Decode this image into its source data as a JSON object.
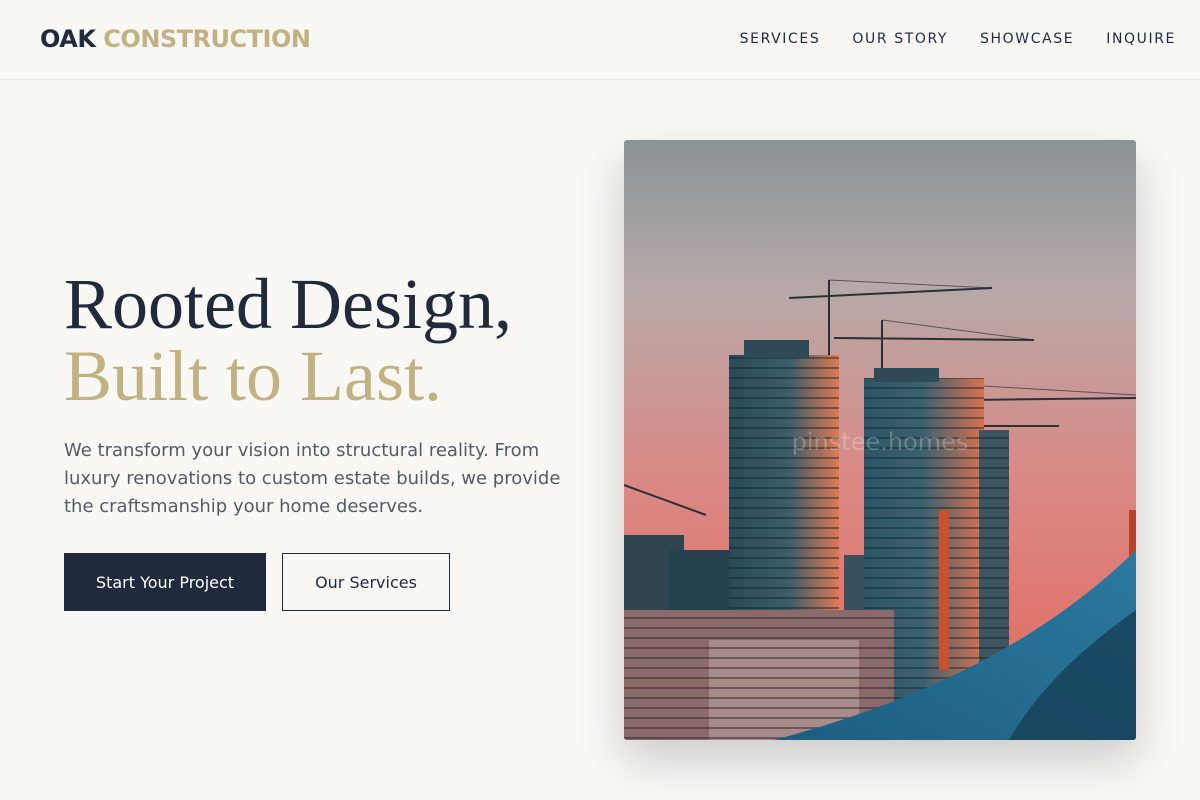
{
  "brand": {
    "name_part1": "OAK",
    "name_part2": "CONSTRUCTION",
    "primary_color": "#1f2a3d",
    "accent_color": "#c2b282"
  },
  "nav": {
    "items": [
      {
        "label": "SERVICES"
      },
      {
        "label": "OUR STORY"
      },
      {
        "label": "SHOWCASE"
      },
      {
        "label": "INQUIRE"
      }
    ]
  },
  "hero": {
    "headline_line1": "Rooted Design,",
    "headline_line2": "Built to Last.",
    "description": "We transform your vision into structural reality. From luxury renovations to custom estate builds, we provide the craftsmanship your home deserves.",
    "primary_button": "Start Your Project",
    "secondary_button": "Our Services",
    "image_watermark": "pinstee.homes"
  }
}
